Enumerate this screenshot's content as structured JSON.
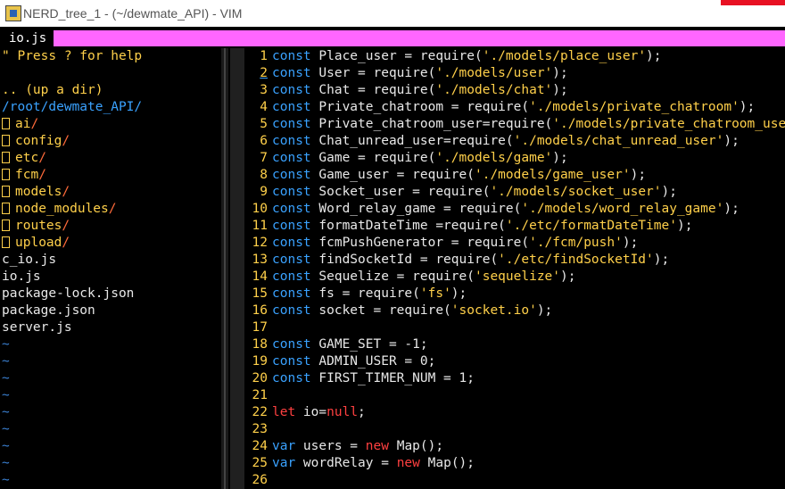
{
  "window": {
    "title": "NERD_tree_1 - (~/dewmate_API) - VIM"
  },
  "tabline": {
    "active_tab": "io.js"
  },
  "nerdtree": {
    "help": "\" Press ? for help",
    "up_dir": ".. (up a dir)",
    "root": "/root/dewmate_API/",
    "dirs": [
      "ai",
      "config",
      "etc",
      "fcm",
      "models",
      "node_modules",
      "routes",
      "upload"
    ],
    "files": [
      "c_io.js",
      "io.js",
      "package-lock.json",
      "package.json",
      "server.js"
    ],
    "active_file": "io.js",
    "tilde": "~"
  },
  "editor": {
    "current_line": 2,
    "lines": [
      {
        "n": "1",
        "kw": "const",
        "pre": " Place_user = require(",
        "str": "'./models/place_user'",
        "post": ");"
      },
      {
        "n": "2",
        "kw": "const",
        "pre": " User = require(",
        "str": "'./models/user'",
        "post": ");"
      },
      {
        "n": "3",
        "kw": "const",
        "pre": " Chat = require(",
        "str": "'./models/chat'",
        "post": ");"
      },
      {
        "n": "4",
        "kw": "const",
        "pre": " Private_chatroom = require(",
        "str": "'./models/private_chatroom'",
        "post": ");"
      },
      {
        "n": "5",
        "kw": "const",
        "pre": " Private_chatroom_user=require(",
        "str": "'./models/private_chatroom_user'",
        "post": ");"
      },
      {
        "n": "6",
        "kw": "const",
        "pre": " Chat_unread_user=require(",
        "str": "'./models/chat_unread_user'",
        "post": ");"
      },
      {
        "n": "7",
        "kw": "const",
        "pre": " Game = require(",
        "str": "'./models/game'",
        "post": ");"
      },
      {
        "n": "8",
        "kw": "const",
        "pre": " Game_user = require(",
        "str": "'./models/game_user'",
        "post": ");"
      },
      {
        "n": "9",
        "kw": "const",
        "pre": " Socket_user = require(",
        "str": "'./models/socket_user'",
        "post": ");"
      },
      {
        "n": "10",
        "kw": "const",
        "pre": " Word_relay_game = require(",
        "str": "'./models/word_relay_game'",
        "post": ");"
      },
      {
        "n": "11",
        "kw": "const",
        "pre": " formatDateTime =require(",
        "str": "'./etc/formatDateTime'",
        "post": ");"
      },
      {
        "n": "12",
        "kw": "const",
        "pre": " fcmPushGenerator = require(",
        "str": "'./fcm/push'",
        "post": ");"
      },
      {
        "n": "13",
        "kw": "const",
        "pre": " findSocketId = require(",
        "str": "'./etc/findSocketId'",
        "post": ");"
      },
      {
        "n": "14",
        "kw": "const",
        "pre": " Sequelize = require(",
        "str": "'sequelize'",
        "post": ");"
      },
      {
        "n": "15",
        "kw": "const",
        "pre": " fs = require(",
        "str": "'fs'",
        "post": ");"
      },
      {
        "n": "16",
        "kw": "const",
        "pre": " socket = require(",
        "str": "'socket.io'",
        "post": ");"
      },
      {
        "n": "17",
        "kw": "",
        "pre": "",
        "str": "",
        "post": ""
      },
      {
        "n": "18",
        "kw": "const",
        "pre": " GAME_SET = -1;",
        "str": "",
        "post": ""
      },
      {
        "n": "19",
        "kw": "const",
        "pre": " ADMIN_USER = 0;",
        "str": "",
        "post": ""
      },
      {
        "n": "20",
        "kw": "const",
        "pre": " FIRST_TIMER_NUM = 1;",
        "str": "",
        "post": ""
      },
      {
        "n": "21",
        "kw": "",
        "pre": "",
        "str": "",
        "post": ""
      },
      {
        "n": "22",
        "kw2": "let",
        "pre": " io=",
        "kw2b": "null",
        "post": ";"
      },
      {
        "n": "23",
        "kw": "",
        "pre": "",
        "str": "",
        "post": ""
      },
      {
        "n": "24",
        "kw": "var",
        "pre": " users = ",
        "kw2b": "new",
        "post": " Map();"
      },
      {
        "n": "25",
        "kw": "var",
        "pre": " wordRelay = ",
        "kw2b": "new",
        "post": " Map();"
      },
      {
        "n": "26",
        "kw": "",
        "pre": "",
        "str": "",
        "post": ""
      }
    ]
  },
  "colors": {
    "tabline": "#ff66ff",
    "keyword": "#3aa2ff",
    "string": "#ffd04a",
    "special": "#ff4040"
  }
}
